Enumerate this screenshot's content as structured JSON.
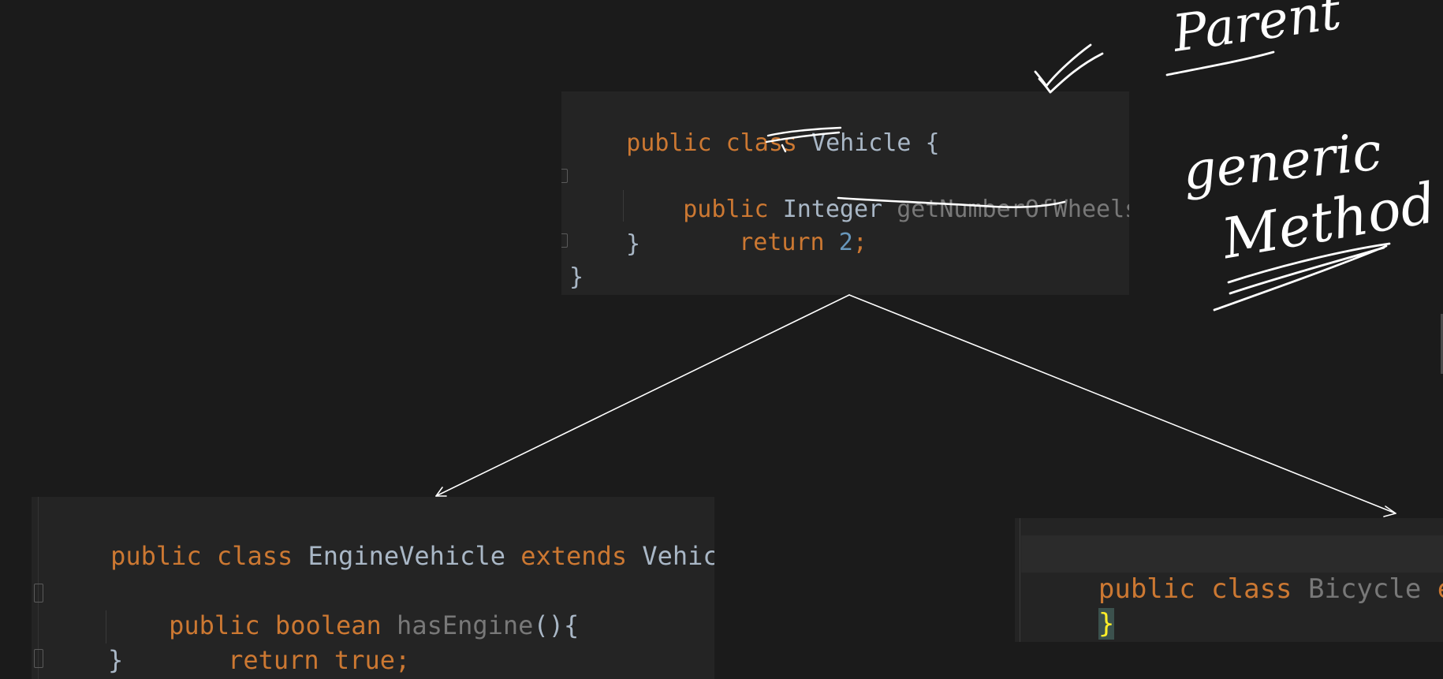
{
  "vehicle": {
    "line1": {
      "kw": "public class ",
      "name": "Vehicle",
      "rest": " {"
    },
    "line2": {
      "kw": "public ",
      "type": "Integer ",
      "method": "getNumberOfWheels",
      "rest": "(){"
    },
    "line3": {
      "kw": "return ",
      "num": "2",
      "semi": ";"
    },
    "line4": "}",
    "line5": "}"
  },
  "engine_vehicle": {
    "line1": {
      "kw": "public class ",
      "name": "EngineVehicle",
      "ext": " extends ",
      "parent": "Vehicle{"
    },
    "line2": {
      "kw": "public boolean ",
      "method": "hasEngine",
      "rest": "(){"
    },
    "line3": {
      "kw": "return true",
      "semi": ";"
    },
    "line4": "}"
  },
  "bicycle": {
    "line1": {
      "kw": "public class ",
      "name": "Bicycle",
      "ext": " exte"
    },
    "line2": "}"
  },
  "annotations": {
    "parent": "Parent",
    "generic": "generic",
    "method": "Method"
  },
  "colors": {
    "background": "#1b1b1b",
    "panel": "#242424",
    "keyword": "#cc7832",
    "identifier": "#a9b7c6",
    "unused_method": "#787878",
    "number": "#6897bb",
    "ink": "#ffffff"
  }
}
